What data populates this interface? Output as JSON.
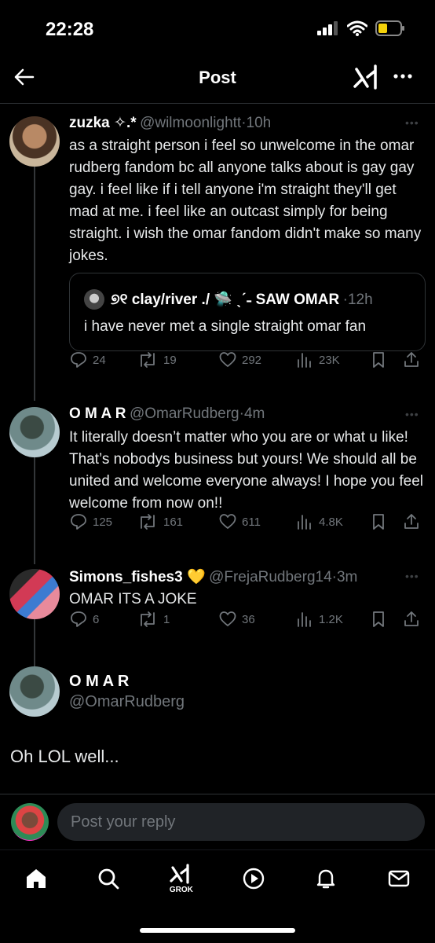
{
  "status_bar": {
    "time": "22:28"
  },
  "header": {
    "title": "Post"
  },
  "tweets": [
    {
      "name": "zuzka ✧.*",
      "handle": "@wilmoonlightt",
      "time": "10h",
      "text": "as a straight person i feel so unwelcome in the omar rudberg fandom bc all anyone talks about is gay gay gay. i feel like if i tell anyone i'm straight they'll get mad at me. i feel like an outcast simply for being straight. i wish the omar fandom didn't make so many jokes.",
      "quote": {
        "name": "୭୧ clay/river ./ 🛸 ˎˊ˗ SAW OMAR",
        "time": "12h",
        "text": "i have never met a single straight omar fan"
      },
      "stats": {
        "replies": "24",
        "reposts": "19",
        "likes": "292",
        "views": "23K"
      }
    },
    {
      "name": "O M A R",
      "handle": "@OmarRudberg",
      "time": "4m",
      "text": "It literally doesn’t matter who you are or what u like! That’s nobodys business but yours! We should all be united and welcome everyone always! I hope you feel welcome from now on!!",
      "stats": {
        "replies": "125",
        "reposts": "161",
        "likes": "611",
        "views": "4.8K"
      }
    },
    {
      "name": "Simons_fishes3 💛",
      "handle": "@FrejaRudberg14",
      "time": "3m",
      "text": "OMAR ITS A JOKE",
      "stats": {
        "replies": "6",
        "reposts": "1",
        "likes": "36",
        "views": "1.2K"
      }
    }
  ],
  "main_post": {
    "name": "O M A R",
    "handle": "@OmarRudberg",
    "text": "Oh LOL well..."
  },
  "reply_bar": {
    "placeholder": "Post your reply"
  },
  "bottom_nav": {
    "grok_label": "GROK"
  },
  "colors": {
    "background": "#000000",
    "muted": "#71767b",
    "divider": "#2f3336",
    "reply_box": "#202327"
  }
}
